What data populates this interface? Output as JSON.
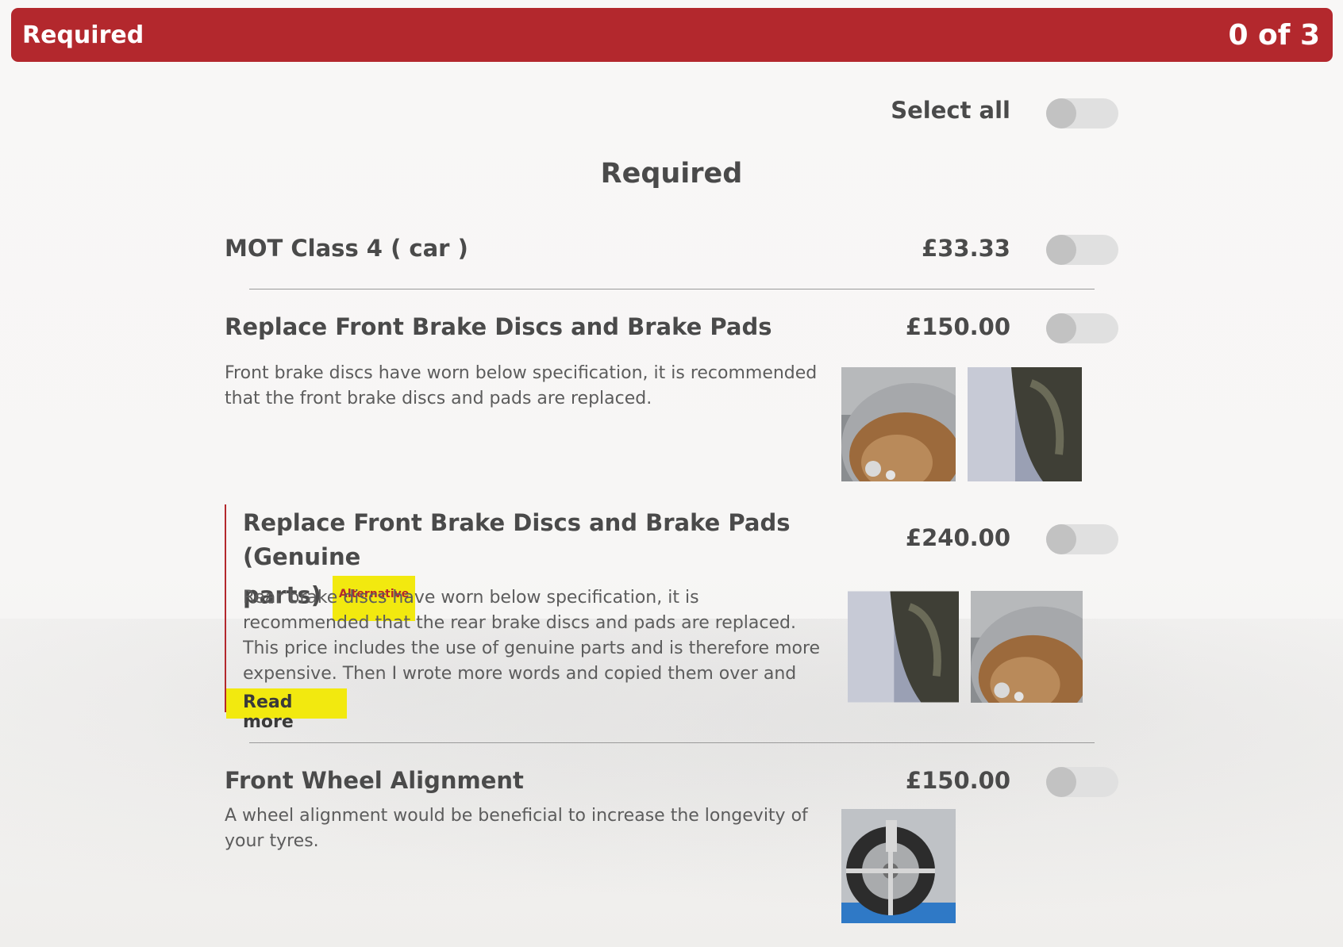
{
  "banner": {
    "title": "Required",
    "count": "0 of 3"
  },
  "select_all": {
    "label": "Select all"
  },
  "section": {
    "title": "Required"
  },
  "items": [
    {
      "title": "MOT Class 4 ( car )",
      "price": "£33.33"
    },
    {
      "title": "Replace Front Brake Discs and Brake Pads",
      "price": "£150.00",
      "description": "Front brake discs have worn below specification, it is recommended that the front brake discs and pads are replaced."
    },
    {
      "title_line1": "Replace Front Brake Discs and Brake Pads (Genuine",
      "title_line2": "parts)",
      "badge": "Alternative",
      "price": "£240.00",
      "description": "Rear brake discs have worn below specification, it is recommended that the rear brake discs and pads are replaced. This price includes the use of genuine parts and is therefore more expensive. Then I wrote more words and copied them over and over to make the",
      "read_more": "Read more"
    },
    {
      "title": "Front Wheel Alignment",
      "price": "£150.00",
      "description": "A wheel alignment would be beneficial to increase the longevity of your tyres."
    }
  ],
  "colors": {
    "brand_red": "#b3282d",
    "highlight_yellow": "#f2e90f",
    "toggle_track": "#e0e0e0",
    "toggle_knob": "#c2c2c2"
  },
  "icons": [
    "brake-disc-photo",
    "brake-pad-photo",
    "wheel-alignment-photo"
  ]
}
